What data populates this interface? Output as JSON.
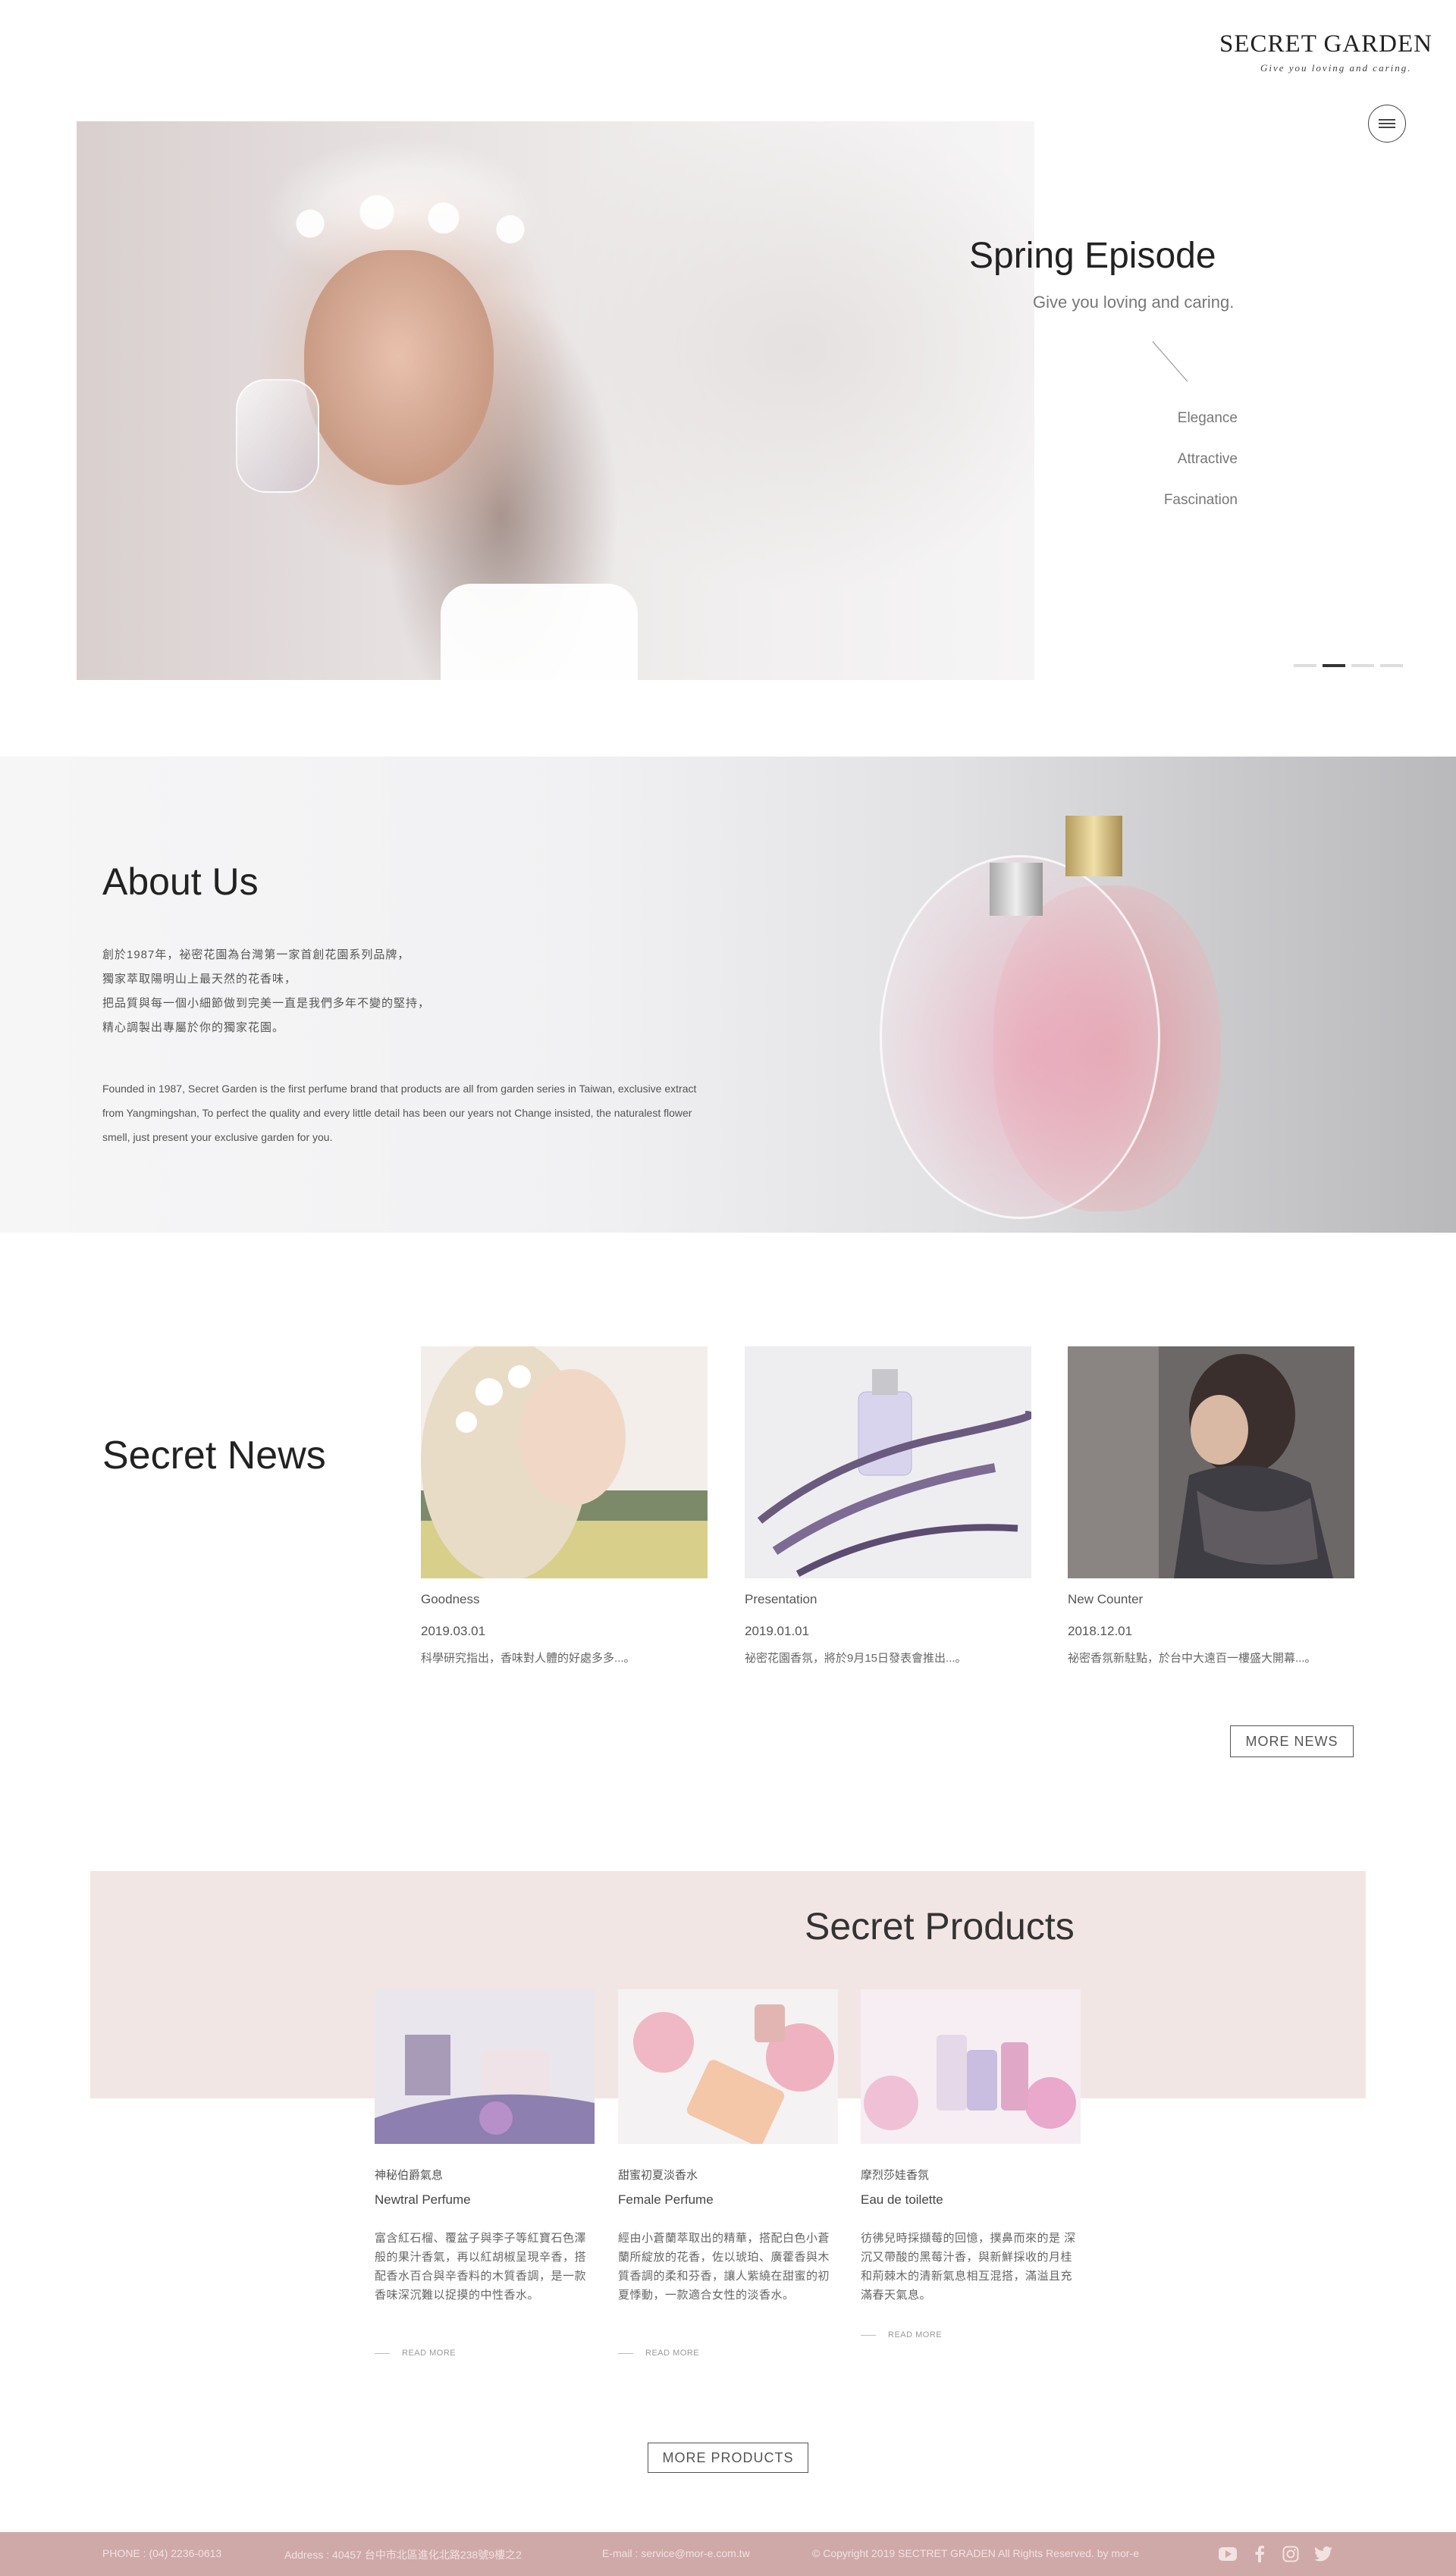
{
  "header": {
    "brand": "SECRET GARDEN",
    "tagline": "Give you loving and caring."
  },
  "hero": {
    "title": "Spring Episode",
    "subtitle": "Give you loving and caring.",
    "features": [
      "Elegance",
      "Attractive",
      "Fascination"
    ],
    "slides_total": 4,
    "active_slide": 2
  },
  "about": {
    "title": "About Us",
    "cn_lines": [
      "創於1987年，祕密花園為台灣第一家首創花園系列品牌，",
      "獨家萃取陽明山上最天然的花香味，",
      "把品質與每一個小細節做到完美一直是我們多年不變的堅持，",
      "精心調製出專屬於你的獨家花園。"
    ],
    "en_text": "Founded in 1987, Secret Garden is the first perfume brand that products are all from garden series in Taiwan, exclusive extract from Yangmingshan, To perfect the quality and every little detail has been our years not Change insisted, the naturalest flower smell, just present your exclusive garden for you."
  },
  "news": {
    "title": "Secret News",
    "items": [
      {
        "category": "Goodness",
        "date": "2019.03.01",
        "desc": "科學研究指出，香味對人體的好處多多...。"
      },
      {
        "category": "Presentation",
        "date": "2019.01.01",
        "desc": "祕密花園香氛，將於9月15日發表會推出...。"
      },
      {
        "category": "New Counter",
        "date": "2018.12.01",
        "desc": "祕密香氛新駐點，於台中大遠百一樓盛大開幕...。"
      }
    ],
    "more_label": "MORE NEWS"
  },
  "products": {
    "title": "Secret Products",
    "items": [
      {
        "cn": "神秘伯爵氣息",
        "en": "Newtral Perfume",
        "desc": "富含紅石榴、覆盆子與李子等紅寶石色澤 般的果汁香氣，再以紅胡椒呈現辛香，搭 配香水百合與辛香料的木質香調，是一款 香味深沉難以捉摸的中性香水。",
        "read_more": "READ MORE"
      },
      {
        "cn": "甜蜜初夏淡香水",
        "en": "Female Perfume",
        "desc": "經由小蒼蘭萃取出的精華，搭配白色小蒼 蘭所綻放的花香，佐以琥珀、廣藿香與木 質香調的柔和芬香，讓人紫繞在甜蜜的初 夏悸動，一款適合女性的淡香水。",
        "read_more": "READ MORE"
      },
      {
        "cn": "摩烈莎娃香氛",
        "en": "Eau de toilette",
        "desc": "彷彿兒時採擷莓的回憶，撲鼻而來的是 深沉又帶酸的黑莓汁香，與新鮮採收的月桂 和荊棘木的清新氣息相互混搭，滿溢且充 滿春天氣息。",
        "read_more": "READ MORE"
      }
    ],
    "more_label": "MORE PRODUCTS"
  },
  "footer": {
    "phone": "PHONE : (04) 2236-0613",
    "address": "Address : 40457 台中市北區進化北路238號9樓之2",
    "email": "E-mail : service@mor-e.com.tw",
    "copyright": "© Copyright 2019 SECTRET GRADEN All Rights Reserved. by mor-e",
    "social_icons": [
      "youtube-icon",
      "facebook-icon",
      "instagram-icon",
      "twitter-icon"
    ]
  },
  "colors": {
    "footer_bg": "#cfa9a8",
    "product_band": "#f2e6e4",
    "text_dark": "#222222"
  }
}
